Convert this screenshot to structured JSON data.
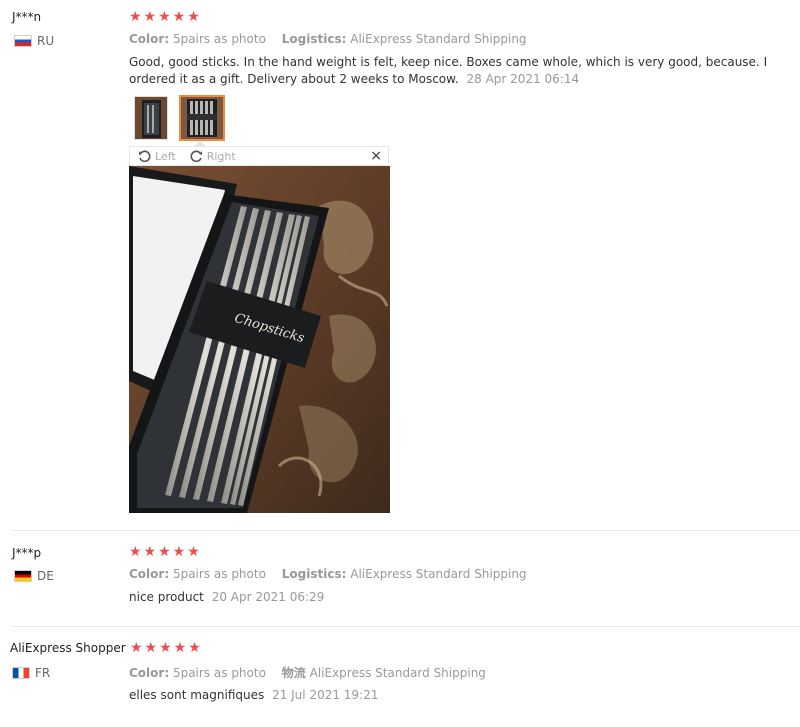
{
  "reviews": [
    {
      "user": "J***n",
      "country": "RU",
      "rating_stars": "★★★★★",
      "color_label": "Color:",
      "color_value": "5pairs as photo",
      "logistics_label": "Logistics:",
      "logistics_value": "AliExpress Standard Shipping",
      "text": "Good, good sticks. In the hand weight is felt, keep nice. Boxes came whole, which is very good, because. I ordered it as a gift. Delivery about 2 weeks to Moscow.",
      "date": "28 Apr 2021 06:14"
    },
    {
      "user": "J***p",
      "country": "DE",
      "rating_stars": "★★★★★",
      "color_label": "Color:",
      "color_value": "5pairs as photo",
      "logistics_label": "Logistics:",
      "logistics_value": "AliExpress Standard Shipping",
      "text": "nice product",
      "date": "20 Apr 2021 06:29"
    },
    {
      "user": "AliExpress Shopper",
      "country": "FR",
      "rating_stars": "★★★★★",
      "color_label": "Color:",
      "color_value": "5pairs as photo",
      "logistics_label": "物流",
      "logistics_value": "AliExpress Standard Shipping",
      "text": "elles sont magnifiques",
      "date": "21 Jul 2021 19:21"
    }
  ],
  "viewer": {
    "rotate_left_label": "Left",
    "rotate_right_label": "Right",
    "close_symbol": "×",
    "photo_label": "Chopsticks"
  },
  "colors": {
    "star": "#ef4d4d",
    "active_thumb_border": "#f08a3c",
    "muted_text": "#999999"
  }
}
